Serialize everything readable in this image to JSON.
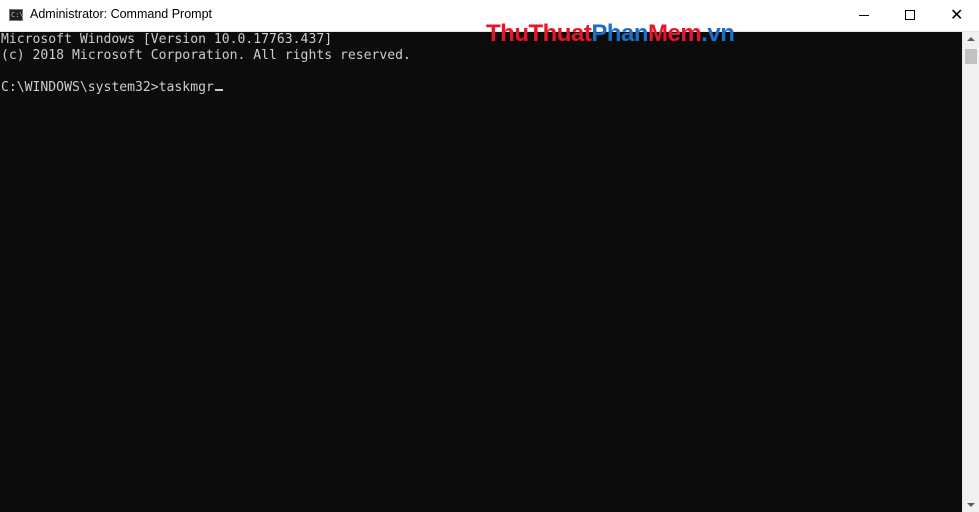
{
  "window": {
    "title": "Administrator: Command Prompt",
    "icon": "cmd-icon",
    "icon_glyph": "C:\\",
    "controls": {
      "minimize": "minimize-icon",
      "maximize": "maximize-icon",
      "close_glyph": "✕"
    }
  },
  "watermark": {
    "part1": "Thu",
    "part2": "Thuat",
    "part3": "Phan",
    "part4": "Mem",
    "part5": ".vn"
  },
  "console": {
    "lines": [
      "Microsoft Windows [Version 10.0.17763.437]",
      "(c) 2018 Microsoft Corporation. All rights reserved.",
      "",
      "C:\\WINDOWS\\system32>taskmgr"
    ]
  },
  "colors": {
    "console_bg": "#0c0c0c",
    "console_fg": "#cccccc",
    "titlebar_bg": "#ffffff",
    "watermark_red": "#e8152a",
    "watermark_blue": "#1d6ec6"
  }
}
